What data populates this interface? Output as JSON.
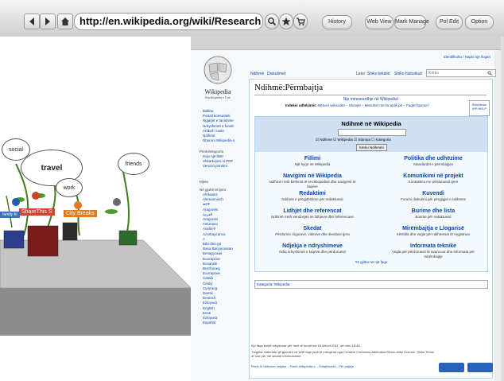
{
  "browser": {
    "url": "http://en.wikipedia.org/wiki/Research",
    "buttons": [
      "History",
      "Web View",
      "Mark Manage",
      "Pol Edit",
      "Option"
    ]
  },
  "scene": {
    "bubbles": [
      "social",
      "travel",
      "work",
      "friends"
    ],
    "tags": [
      "ShareThis S",
      "City Breaks",
      "family fri"
    ]
  },
  "wiki": {
    "user_link": "Identifikohu / Hapni një llogari",
    "logo_name": "Wikipedia",
    "logo_tagline": "Enciklopedia e Lirë",
    "tabs": {
      "left1": "Ndihmë",
      "left2": "Diskutimet",
      "read": "Lexo",
      "edit": "Shiko tekstin",
      "history": "Shiko historikun",
      "search_placeholder": "Kërko"
    },
    "sidebar": {
      "nav": [
        "Ballina",
        "Portali komuniteti",
        "Ngjarjet e tanishme",
        "Ndryshimet e fundit",
        "Artikull i rastit",
        "Ndihmë",
        "Dhuroni Wikipedia-s"
      ],
      "print_head": "Printo/eksporto",
      "print": [
        "Krijo një libër",
        "Shkarkojeni si PDF",
        "Version printimi"
      ],
      "tools_head": "Mjete",
      "lang_head": "Në gjuhë të tjera",
      "langs": [
        "Afrikaans",
        "Alemannisch",
        "ወርቅ",
        "Aragonés",
        "العربية",
        "Aragonés",
        "Asturianu",
        "Avañe'ẽ",
        "Azərbaycanca",
        "ᨅ",
        "Bân-lâm-gú",
        "Basa Banyumasan",
        "Беларуская",
        "Български",
        "Bosanski",
        "Brezhoneg",
        "Български",
        "Català",
        "Česky",
        "Cymraeg",
        "Dansk",
        "Deutsch",
        "Ελληνικά",
        "English",
        "Eesti",
        "Ελληνικά",
        "Español"
      ]
    },
    "title": "Ndihmë:Përmbajtja",
    "intro_link": "Nje mireseardhje në Wikipedia!",
    "intro_label": "Indeksi udhëzimit:",
    "intro_text": "Mësoni wikicodet – Shenjtit – Mesohet me tw aplik pë – Faqet fqumuri",
    "side_box": "Shkurtesa: WP:HELP",
    "box_title": "Ndihmë në Wikipedia",
    "box_search_button": "Kërko Ndihmën",
    "box_checks": [
      "Ndihmë",
      "Wikipedia",
      "Stampa",
      "Kategoria"
    ],
    "sections": [
      {
        "title": "Fillimi",
        "desc": "Një hyrje në Wikipedia"
      },
      {
        "title": "Politika dhe udhëzime",
        "desc": "Standardet e përmbajtjes"
      },
      {
        "title": "Navigimi në Wikipedia",
        "desc": "Ndihmë rreth kërkimit të enciklopedisë dhe navigimit të faqeve"
      },
      {
        "title": "Komunikimi në projekt",
        "desc": "Kontaktimi me përdoruesit tjerë"
      },
      {
        "title": "Redaktimi",
        "desc": "Ndihmë e përgjithshme për redaktuesit"
      },
      {
        "title": "Kuvendi",
        "desc": "Forumi diskutimi për përgjigjet e ndihmës"
      },
      {
        "title": "Lidhjet dhe referencat",
        "desc": "Ndihmë rreth vendosjes së lidhjeve dhe referencave"
      },
      {
        "title": "Burime dhe lista",
        "desc": "Burime për redaktuesit"
      },
      {
        "title": "Skedat",
        "desc": "Përdorimi i figurave, videove dhe skedave tjera"
      },
      {
        "title": "Mirëmbajtja e Llogarisë",
        "desc": "Këshilla dhe vegla për ndihmesat të regjistruar"
      },
      {
        "title": "Ndjekja e ndryshimeve",
        "desc": "Ndiq ndryshimet e faqeve dhe përdoruesit"
      },
      {
        "title": "Informata teknike",
        "desc": "Vegla për përdoruesit të avancuar dhe informata për mirëmbajtje"
      }
    ],
    "more_link": "Të gjitha në një faqe",
    "categories": "Kategoria: Wikipedia",
    "footer_modified": "Kjo faqe është ndryshuar për herë të fundit më 16 shkurt 2011, në orën 18:45.",
    "footer_license": "Tregitha materiale që gjenden në këtë faqe janë të mbrojtura nga Creative Commons Attribution/Share-Alike License. Shiko Terms of Use për më shumë informacione.",
    "footer_links": "Rreth të dhënave vetjake – Rreth Wikipedia-s – Shfajësimet – Për pajisje"
  },
  "colors": {
    "link": "#0645ad",
    "box_header": "#cee0f2",
    "tag_red": "#d0452a",
    "tag_orange": "#e07b22",
    "tag_blue": "#3a6fc4"
  }
}
